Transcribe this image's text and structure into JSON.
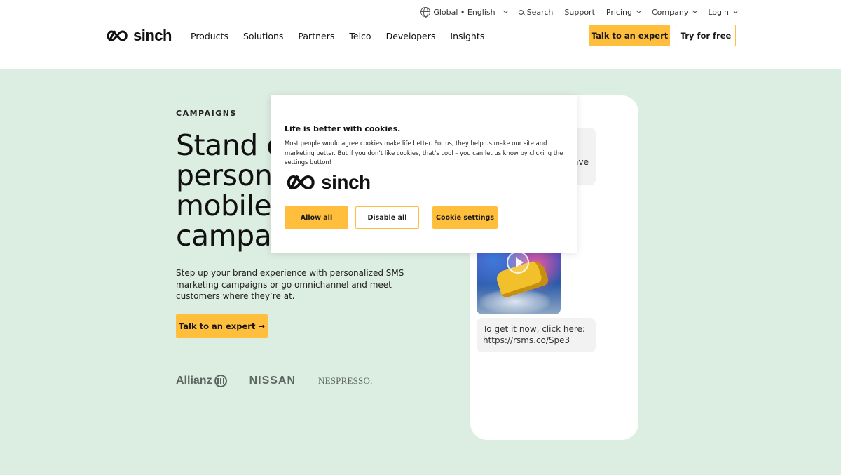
{
  "header": {
    "utility": {
      "locale": "Global • English",
      "search": "Search",
      "support": "Support",
      "pricing": "Pricing",
      "company": "Company",
      "login": "Login"
    },
    "logo_text": "sinch",
    "nav": [
      "Products",
      "Solutions",
      "Partners",
      "Telco",
      "Developers",
      "Insights"
    ],
    "talk_button": "Talk to an expert",
    "try_button": "Try for free"
  },
  "hero": {
    "eyebrow": "CAMPAIGNS",
    "headline_lines": [
      "Stand o",
      "person",
      "mobile",
      "campa"
    ],
    "subcopy": "Step up your brand experience with personalized SMS marketing campaigns or go omnichannel and meet customers where they’re at.",
    "cta": "Talk to an expert",
    "cta_arrow": "→",
    "customer_logos": {
      "allianz": "Allianz",
      "nissan": "NISSAN",
      "nespresso": "NESPRESSO."
    }
  },
  "phone": {
    "top_bubble_fragment": "ave",
    "link_bubble": "To get it now, click here: https://rsms.co/Spe3"
  },
  "cookie_banner": {
    "title": "Life is better with cookies.",
    "body": "Most people would agree cookies make life better. For us, they help us make our site and marketing better. But if you don’t like cookies, that’s cool – you can let us know by clicking the settings button!",
    "logo_text": "sinch",
    "allow_all": "Allow all",
    "disable_all": "Disable all",
    "cookie_settings": "Cookie settings"
  },
  "colors": {
    "accent": "#ffbe3c",
    "hero_background": "#dcede2",
    "text": "#111111"
  }
}
